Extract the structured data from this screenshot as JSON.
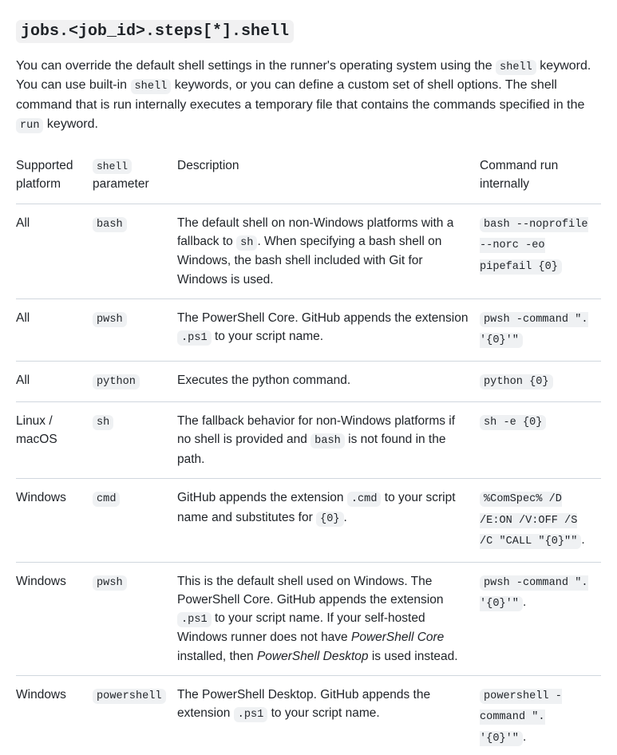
{
  "heading_code": "jobs.<job_id>.steps[*].shell",
  "intro": {
    "t1": "You can override the default shell settings in the runner's operating system using the ",
    "c1": "shell",
    "t2": " keyword. You can use built-in ",
    "c2": "shell",
    "t3": " keywords, or you can define a custom set of shell options. The shell command that is run internally executes a temporary file that contains the commands specified in the ",
    "c3": "run",
    "t4": " keyword."
  },
  "table": {
    "headers": {
      "platform": "Supported platform",
      "param_code": "shell",
      "param_text": " parameter",
      "description": "Description",
      "command": "Command run internally"
    },
    "rows": [
      {
        "platform": "All",
        "param": "bash",
        "desc_parts": [
          {
            "text": "The default shell on non-Windows platforms with a fallback to "
          },
          {
            "code": "sh"
          },
          {
            "text": ". When specifying a bash shell on Windows, the bash shell included with Git for Windows is used."
          }
        ],
        "cmd_parts": [
          {
            "code": "bash --noprofile --norc -eo pipefail {0}"
          }
        ]
      },
      {
        "platform": "All",
        "param": "pwsh",
        "desc_parts": [
          {
            "text": "The PowerShell Core. GitHub appends the extension "
          },
          {
            "code": ".ps1"
          },
          {
            "text": " to your script name."
          }
        ],
        "cmd_parts": [
          {
            "code": "pwsh -command \". '{0}'\""
          }
        ]
      },
      {
        "platform": "All",
        "param": "python",
        "desc_parts": [
          {
            "text": "Executes the python command."
          }
        ],
        "cmd_parts": [
          {
            "code": "python {0}"
          }
        ]
      },
      {
        "platform": "Linux / macOS",
        "param": "sh",
        "desc_parts": [
          {
            "text": "The fallback behavior for non-Windows platforms if no shell is provided and "
          },
          {
            "code": "bash"
          },
          {
            "text": " is not found in the path."
          }
        ],
        "cmd_parts": [
          {
            "code": "sh -e {0}"
          }
        ]
      },
      {
        "platform": "Windows",
        "param": "cmd",
        "desc_parts": [
          {
            "text": "GitHub appends the extension "
          },
          {
            "code": ".cmd"
          },
          {
            "text": " to your script name and substitutes for "
          },
          {
            "code": "{0}"
          },
          {
            "text": "."
          }
        ],
        "cmd_parts": [
          {
            "code": "%ComSpec% /D /E:ON /V:OFF /S /C \"CALL \"{0}\"\""
          },
          {
            "text": "."
          }
        ]
      },
      {
        "platform": "Windows",
        "param": "pwsh",
        "desc_parts": [
          {
            "text": "This is the default shell used on Windows. The PowerShell Core. GitHub appends the extension "
          },
          {
            "code": ".ps1"
          },
          {
            "text": " to your script name. If your self-hosted Windows runner does not have "
          },
          {
            "em": "PowerShell Core"
          },
          {
            "text": " installed, then "
          },
          {
            "em": "PowerShell Desktop"
          },
          {
            "text": " is used instead."
          }
        ],
        "cmd_parts": [
          {
            "code": "pwsh -command \". '{0}'\""
          },
          {
            "text": "."
          }
        ]
      },
      {
        "platform": "Windows",
        "param": "powershell",
        "desc_parts": [
          {
            "text": "The PowerShell Desktop. GitHub appends the extension "
          },
          {
            "code": ".ps1"
          },
          {
            "text": " to your script name."
          }
        ],
        "cmd_parts": [
          {
            "code": "powershell -command \". '{0}'\""
          },
          {
            "text": "."
          }
        ]
      }
    ]
  }
}
